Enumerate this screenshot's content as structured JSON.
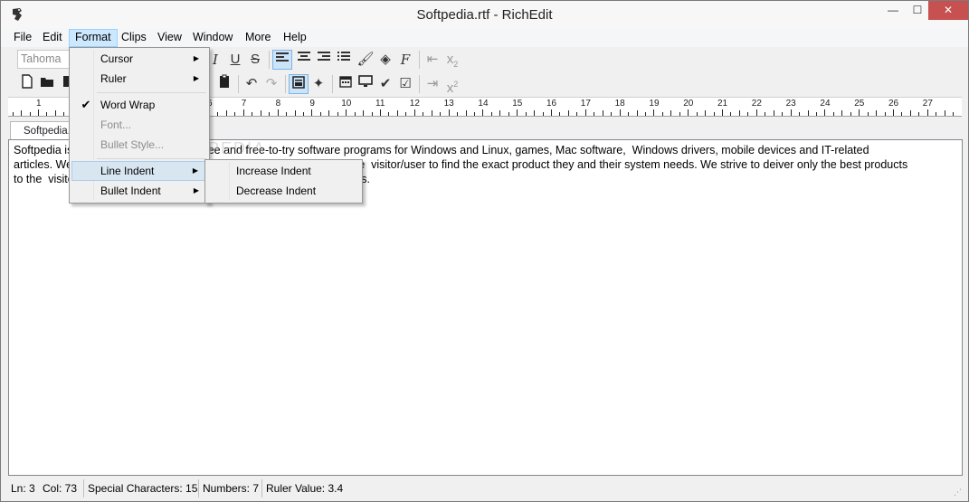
{
  "window": {
    "title": "Softpedia.rtf - RichEdit",
    "minimize": "—",
    "maximize": "☐",
    "close": "✕"
  },
  "menubar": [
    "File",
    "Edit",
    "Format",
    "Clips",
    "View",
    "Window",
    "More",
    "Help"
  ],
  "toolbar1": {
    "font": "Tahoma"
  },
  "ruler": {
    "numbers": [
      "1",
      "2",
      "3",
      "4",
      "5",
      "6",
      "7",
      "8",
      "9",
      "10",
      "11",
      "12",
      "13",
      "14",
      "15",
      "16",
      "17",
      "18",
      "19",
      "20",
      "21",
      "22",
      "23",
      "24",
      "25",
      "26",
      "27"
    ]
  },
  "tab": {
    "label": "Softpedia."
  },
  "editor": {
    "lines": [
      "Softpedia is a library of over 400,000 free and free-to-try software programs for Windows and Linux, games, Mac software,  Windows drivers, mobile devices and IT-related",
      "articles. We review and categorize these products in order to allow the  visitor/user to find the exact product they and their system needs. We strive to deiver only the best products",
      "to the  visitor/user together with self-made evaluation and review notes."
    ],
    "watermark": "SOFTPEDIA"
  },
  "format_menu": {
    "items": [
      {
        "label": "Cursor",
        "submenu": true
      },
      {
        "label": "Ruler",
        "submenu": true
      },
      {
        "label": "Word Wrap",
        "checked": true
      },
      {
        "label": "Font...",
        "disabled": true
      },
      {
        "label": "Bullet Style...",
        "disabled": true
      },
      {
        "label": "Line Indent",
        "submenu": true
      },
      {
        "label": "Bullet Indent",
        "submenu": true
      }
    ]
  },
  "line_indent_submenu": {
    "items": [
      "Increase Indent",
      "Decrease Indent"
    ]
  },
  "status": {
    "line": "Ln: 3",
    "col": "Col: 73",
    "special": "Special Characters: 15",
    "numbers": "Numbers: 7",
    "ruler_value": "Ruler Value: 3.4"
  },
  "colors": {
    "close_button": "#c75050",
    "menu_open": "#cce8ff",
    "menu_hover": "#d8e6f2"
  }
}
